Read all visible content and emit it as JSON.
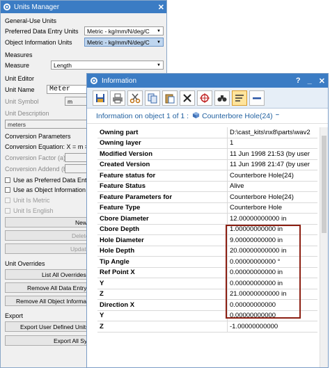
{
  "units_manager": {
    "title": "Units Manager",
    "general_use_units": "General-Use Units",
    "preferred_data_entry_units_label": "Preferred Data Entry Units",
    "preferred_data_entry_units_value": "Metric - kg/mm/N/deg/C",
    "object_information_units_label": "Object Information Units",
    "object_information_units_value": "Metric - kg/mm/N/deg/C",
    "measures": "Measures",
    "measure_label": "Measure",
    "measure_value": "Length",
    "unit_editor": "Unit Editor",
    "unit_name_label": "Unit Name",
    "unit_name_value": "Meter",
    "unit_symbol_label": "Unit Symbol",
    "unit_symbol_value": "m",
    "unit_description_label": "Unit Description",
    "unit_description_value": "meters",
    "conversion_parameters": "Conversion Parameters",
    "conversion_equation": "Conversion Equation: X = m = (X *",
    "conversion_factor_label": "Conversion Factor (a)",
    "conversion_addend_label": "Conversion Addend (b)",
    "use_as_preferred": "Use as Preferred Data Entry Ui",
    "use_as_object_info": "Use as Object Information Uni",
    "unit_is_metric": "Unit Is Metric",
    "unit_is_english": "Unit Is English",
    "new_button": "New",
    "delete_button": "Delete",
    "update_button": "Update",
    "unit_overrides": "Unit Overrides",
    "list_all_overrides": "List All Overrides (",
    "remove_all_data_entry": "Remove All Data Entry O",
    "remove_all_object_info": "Remove All Object Informati",
    "export": "Export",
    "export_user_defined": "Export User Defined Units a",
    "export_all_sys": "Export All Sys"
  },
  "information": {
    "title": "Information",
    "title_controls": [
      "?",
      "_",
      "✕"
    ],
    "header_prefix": "Information on object 1 of 1 :",
    "header_object": "Counterbore Hole(24)",
    "toolbar": [
      "save-icon",
      "print-icon",
      "scissors-icon",
      "copy-icon",
      "paste-icon",
      "delete-icon",
      "target-icon",
      "binoculars-icon",
      "wrap-text-icon",
      "minus-icon"
    ],
    "rows": [
      {
        "k": "Owning part",
        "v": "D:\\cast_kits\\nx8\\parts\\wav2"
      },
      {
        "k": "Owning layer",
        "v": "1"
      },
      {
        "k": "Modified Version",
        "v": "11 Jun 1998 21:53 (by user"
      },
      {
        "k": "Created Version",
        "v": "11 Jun 1998 21:47 (by user"
      },
      {
        "k": "Feature status for",
        "v": "Counterbore Hole(24)"
      },
      {
        "k": "Feature Status",
        "v": "Alive"
      },
      {
        "k": "Feature Parameters for",
        "v": "Counterbore Hole(24)"
      },
      {
        "k": "Feature Type",
        "v": "Counterbore Hole"
      },
      {
        "k": "Cbore Diameter",
        "v": "12.00000000000 in"
      },
      {
        "k": "Cbore Depth",
        "v": "1.00000000000 in"
      },
      {
        "k": "Hole Diameter",
        "v": "9.00000000000 in"
      },
      {
        "k": "Hole Depth",
        "v": "20.00000000000 in"
      },
      {
        "k": "Tip Angle",
        "v": "0.00000000000 °"
      },
      {
        "k": "Ref Point X",
        "v": "0.00000000000 in"
      },
      {
        "k": "Y",
        "v": "0.00000000000 in"
      },
      {
        "k": "Z",
        "v": "21.00000000000 in"
      },
      {
        "k": "Direction X",
        "v": "0.00000000000"
      },
      {
        "k": "Y",
        "v": "0.00000000000"
      },
      {
        "k": "Z",
        "v": "-1.00000000000"
      }
    ]
  }
}
